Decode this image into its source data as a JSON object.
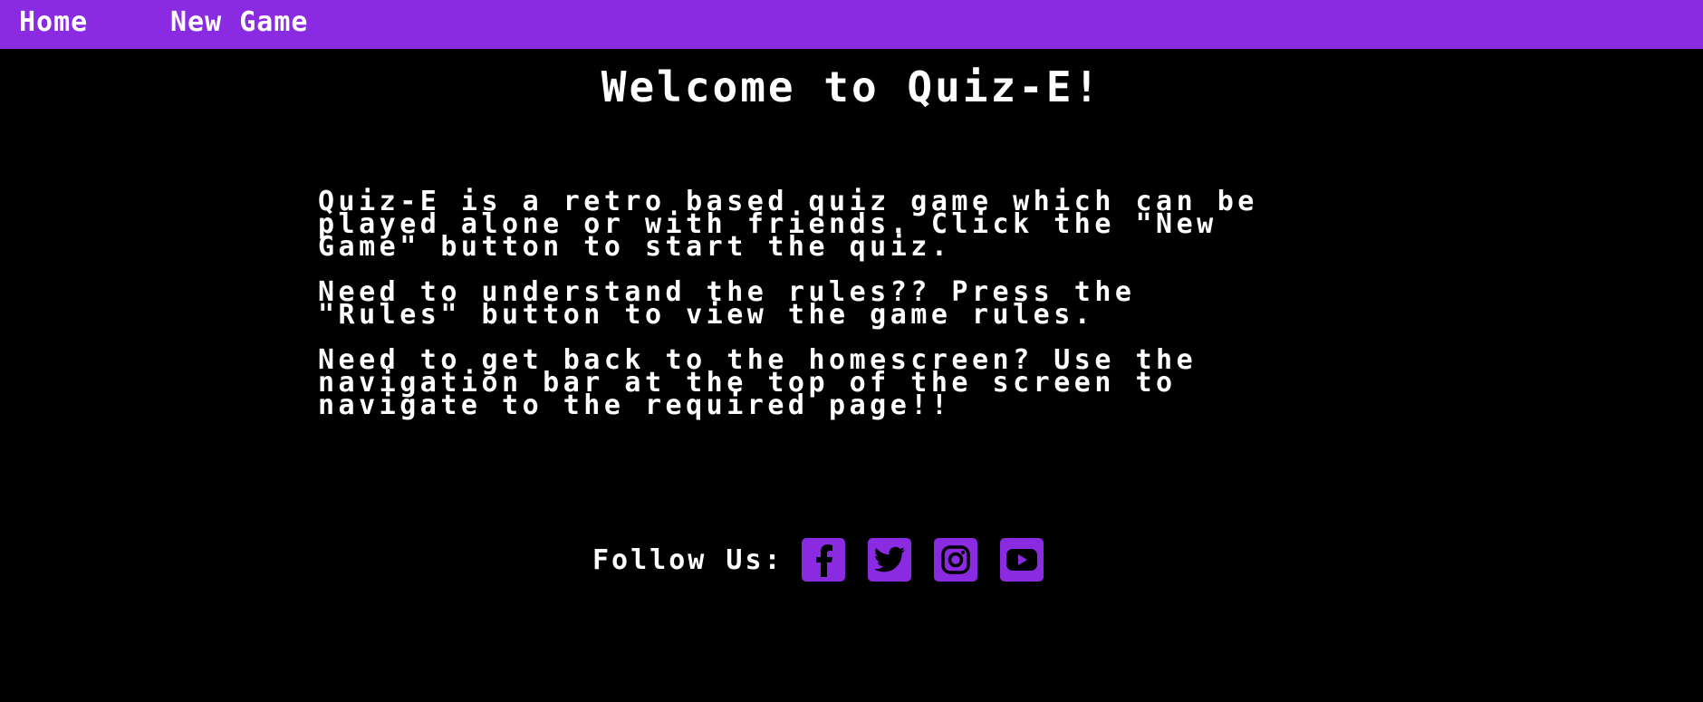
{
  "nav": {
    "home_label": "Home",
    "new_game_label": "New Game"
  },
  "main": {
    "title": "Welcome to Quiz-E!",
    "paragraphs": [
      {
        "lines": [
          "Quiz-E is a retro based quiz game which can be",
          "played alone or with friends. Click the \"New",
          "Game\" button to start the quiz."
        ]
      },
      {
        "lines": [
          "Need to understand the rules?? Press the",
          "\"Rules\" button to view the game rules."
        ]
      },
      {
        "lines": [
          "Need to get back to the homescreen? Use the",
          "navigation bar at the top of the screen to",
          "navigate to the required page!!"
        ]
      }
    ]
  },
  "footer": {
    "follow_label": "Follow Us:",
    "socials": [
      {
        "icon": "facebook-icon"
      },
      {
        "icon": "twitter-icon"
      },
      {
        "icon": "instagram-icon"
      },
      {
        "icon": "youtube-icon"
      }
    ]
  },
  "colors": {
    "accent": "#8a2be2",
    "background": "#000000",
    "text": "#ffffff"
  }
}
